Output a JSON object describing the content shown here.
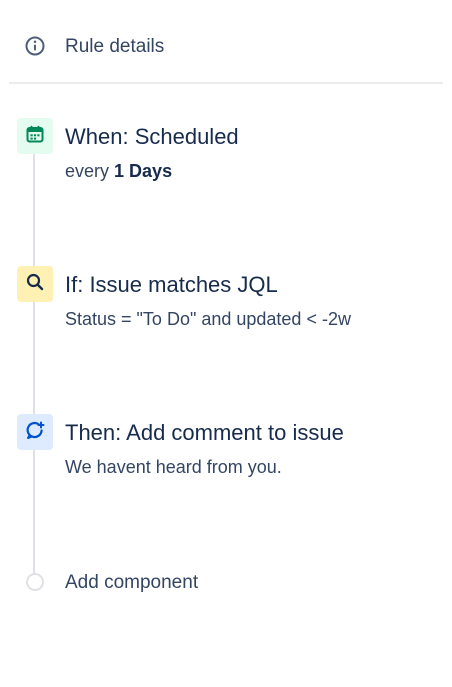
{
  "header": {
    "info_icon": "info-icon",
    "label": "Rule details"
  },
  "steps": [
    {
      "kind": "trigger",
      "icon": "calendar-icon",
      "icon_color": "#00875a",
      "icon_bg": "#e3fcef",
      "title": "When: Scheduled",
      "desc_prefix": "every",
      "desc_bold": "1 Days"
    },
    {
      "kind": "condition",
      "icon": "search-icon",
      "icon_color": "#172b4d",
      "icon_bg": "#fff0b3",
      "title": "If: Issue matches JQL",
      "desc": "Status = \"To Do\" and updated < -2w"
    },
    {
      "kind": "action",
      "icon": "comment-add-icon",
      "icon_color": "#0052cc",
      "icon_bg": "#deebff",
      "title": "Then: Add comment to issue",
      "desc": "We havent heard from you."
    }
  ],
  "add_component": {
    "label": "Add component"
  },
  "colors": {
    "text_primary": "#172b4d",
    "text_secondary": "#344563",
    "timeline": "#dfe1e6",
    "divider": "#ebecf0"
  }
}
